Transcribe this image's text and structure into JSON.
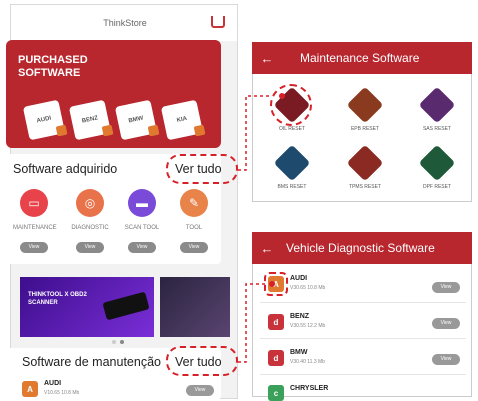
{
  "phone": {
    "title": "ThinkStore",
    "card_title": "PURCHASED SOFTWARE",
    "card_icons": [
      "AUDI",
      "BENZ",
      "BMW",
      "KIA"
    ],
    "section_purchased": "Software adquirido",
    "ver_tudo": "Ver tudo",
    "purchased_items": [
      {
        "label": "MAINTENANCE",
        "color": "#e8434a",
        "glyph": "▭"
      },
      {
        "label": "DIAGNOSTIC",
        "color": "#e8734a",
        "glyph": "◎"
      },
      {
        "label": "SCAN TOOL",
        "color": "#7a4ad8",
        "glyph": "▬"
      },
      {
        "label": "TOOL",
        "color": "#e8834a",
        "glyph": "✎"
      }
    ],
    "view_label": "View",
    "banner_text": "THINKTOOL X OBD2 SCANNER",
    "section_maintenance": "Software de manutenção",
    "ver_tudo_2": "Ver tudo",
    "bottom_item": {
      "name": "AUDI",
      "sub": "V10.65 10.8 Mb"
    }
  },
  "maintenance": {
    "title": "Maintenance Software",
    "back": "←",
    "items": [
      {
        "label": "OIL RESET",
        "color": "#7a1a22"
      },
      {
        "label": "EPB RESET",
        "color": "#8a3a1e"
      },
      {
        "label": "SAS RESET",
        "color": "#5a2a6e"
      },
      {
        "label": "BMS RESET",
        "color": "#1e4a6e"
      },
      {
        "label": "TPMS RESET",
        "color": "#8a2a22"
      },
      {
        "label": "DPF RESET",
        "color": "#1e5a3a"
      }
    ]
  },
  "vehicle": {
    "title": "Vehicle Diagnostic Software",
    "back": "←",
    "items": [
      {
        "name": "AUDI",
        "sub": "V30.65 10.8 Mb",
        "color": "#e07a30",
        "glyph": "A"
      },
      {
        "name": "BENZ",
        "sub": "V30.55 12.2 Mb",
        "color": "#c8323a",
        "glyph": "d"
      },
      {
        "name": "BMW",
        "sub": "V30.40 11.3 Mb",
        "color": "#c8323a",
        "glyph": "d"
      },
      {
        "name": "CHRYSLER",
        "sub": "",
        "color": "#3aa05a",
        "glyph": "c"
      }
    ],
    "view_label": "View"
  }
}
